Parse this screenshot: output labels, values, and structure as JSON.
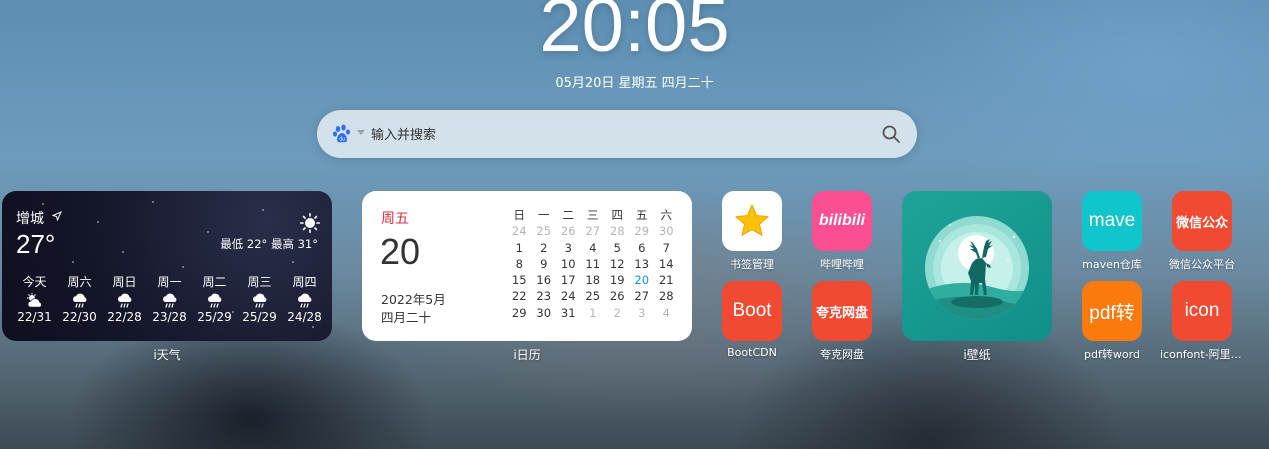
{
  "clock": {
    "time": "20:05",
    "date": "05月20日 星期五 四月二十"
  },
  "search": {
    "placeholder": "输入并搜索",
    "engine_icon": "baidu-paw-icon"
  },
  "weather": {
    "city": "增城",
    "current_temp": "27°",
    "range": "最低 22° 最高 31°",
    "label": "i天气",
    "forecast": [
      {
        "day": "今天",
        "temp": "22/31",
        "icon": "partly-cloudy-icon"
      },
      {
        "day": "周六",
        "temp": "22/30",
        "icon": "rain-icon"
      },
      {
        "day": "周日",
        "temp": "22/28",
        "icon": "rain-icon"
      },
      {
        "day": "周一",
        "temp": "23/28",
        "icon": "rain-icon"
      },
      {
        "day": "周二",
        "temp": "25/29",
        "icon": "rain-icon"
      },
      {
        "day": "周三",
        "temp": "25/29",
        "icon": "rain-icon"
      },
      {
        "day": "周四",
        "temp": "24/28",
        "icon": "rain-icon"
      }
    ]
  },
  "calendar": {
    "weekday": "周五",
    "day": "20",
    "year_month": "2022年5月",
    "lunar": "四月二十",
    "label": "i日历",
    "headers": [
      "日",
      "一",
      "二",
      "三",
      "四",
      "五",
      "六"
    ],
    "weeks": [
      [
        "24",
        "25",
        "26",
        "27",
        "28",
        "29",
        "30"
      ],
      [
        "1",
        "2",
        "3",
        "4",
        "5",
        "6",
        "7"
      ],
      [
        "8",
        "9",
        "10",
        "11",
        "12",
        "13",
        "14"
      ],
      [
        "15",
        "16",
        "17",
        "18",
        "19",
        "20",
        "21"
      ],
      [
        "22",
        "23",
        "24",
        "25",
        "26",
        "27",
        "28"
      ],
      [
        "29",
        "30",
        "31",
        "1",
        "2",
        "3",
        "4"
      ]
    ],
    "today": "20"
  },
  "apps": [
    {
      "name": "书签管理",
      "icon_text": "",
      "icon": "star-icon",
      "color": "#ffffff"
    },
    {
      "name": "哔哩哔哩",
      "icon_text": "bilibili",
      "icon": "bilibili-icon",
      "color": "#fb4f92"
    },
    {
      "name": "BootCDN",
      "icon_text": "Boot",
      "icon": "boot-icon",
      "color": "#f14a32"
    },
    {
      "name": "夸克网盘",
      "icon_text": "夸克网盘",
      "icon": "quark-icon",
      "color": "#f14a32"
    },
    {
      "name": "maven仓库",
      "icon_text": "mave",
      "icon": "maven-icon",
      "color": "#10c5cc"
    },
    {
      "name": "微信公众平台",
      "icon_text": "微信公众",
      "icon": "wechat-icon",
      "color": "#f14a32"
    },
    {
      "name": "pdf转word",
      "icon_text": "pdf转",
      "icon": "pdf-icon",
      "color": "#fa7a0e"
    },
    {
      "name": "iconfont-阿里巴巴",
      "icon_text": "icon",
      "icon": "iconfont-icon",
      "color": "#f14a32"
    }
  ],
  "wallpaper": {
    "label": "i壁纸",
    "icon": "deer-moon-icon"
  }
}
